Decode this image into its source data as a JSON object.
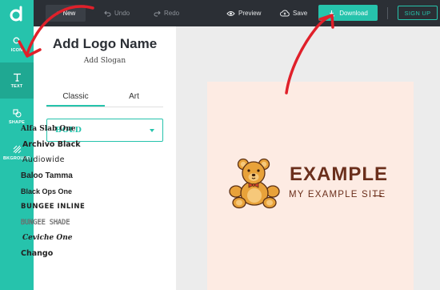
{
  "toolbar": {
    "new_label": "New",
    "undo_label": "Undo",
    "redo_label": "Redo",
    "preview_label": "Preview",
    "save_label": "Save",
    "download_label": "Download",
    "signup_label": "SIGN UP"
  },
  "rail": [
    {
      "label": "ICON",
      "icon": "search-icon"
    },
    {
      "label": "TEXT",
      "icon": "text-icon"
    },
    {
      "label": "SHAPE",
      "icon": "shapes-icon"
    },
    {
      "label": "BKGROUND",
      "icon": "background-icon"
    }
  ],
  "panel": {
    "logo_name": "Add Logo Name",
    "slogan": "Add Slogan",
    "tabs": [
      "Classic",
      "Art"
    ],
    "selected_font": "BOLD",
    "fonts": [
      "Alfa Slab One",
      "Archivo Black",
      "Audiowide",
      "Baloo Tamma",
      "Black Ops One",
      "BUNGEE INLINE",
      "BUNGEE SHADE",
      "Ceviche One",
      "Chango"
    ]
  },
  "canvas": {
    "title": "EXAMPLE",
    "subtitle": "MY EXAMPLE SITE"
  },
  "colors": {
    "accent": "#26c3ac",
    "topbar": "#2b2f35",
    "logo_text": "#6b2f1c",
    "artboard": "#fdebe3",
    "annotation": "#e0202a"
  }
}
